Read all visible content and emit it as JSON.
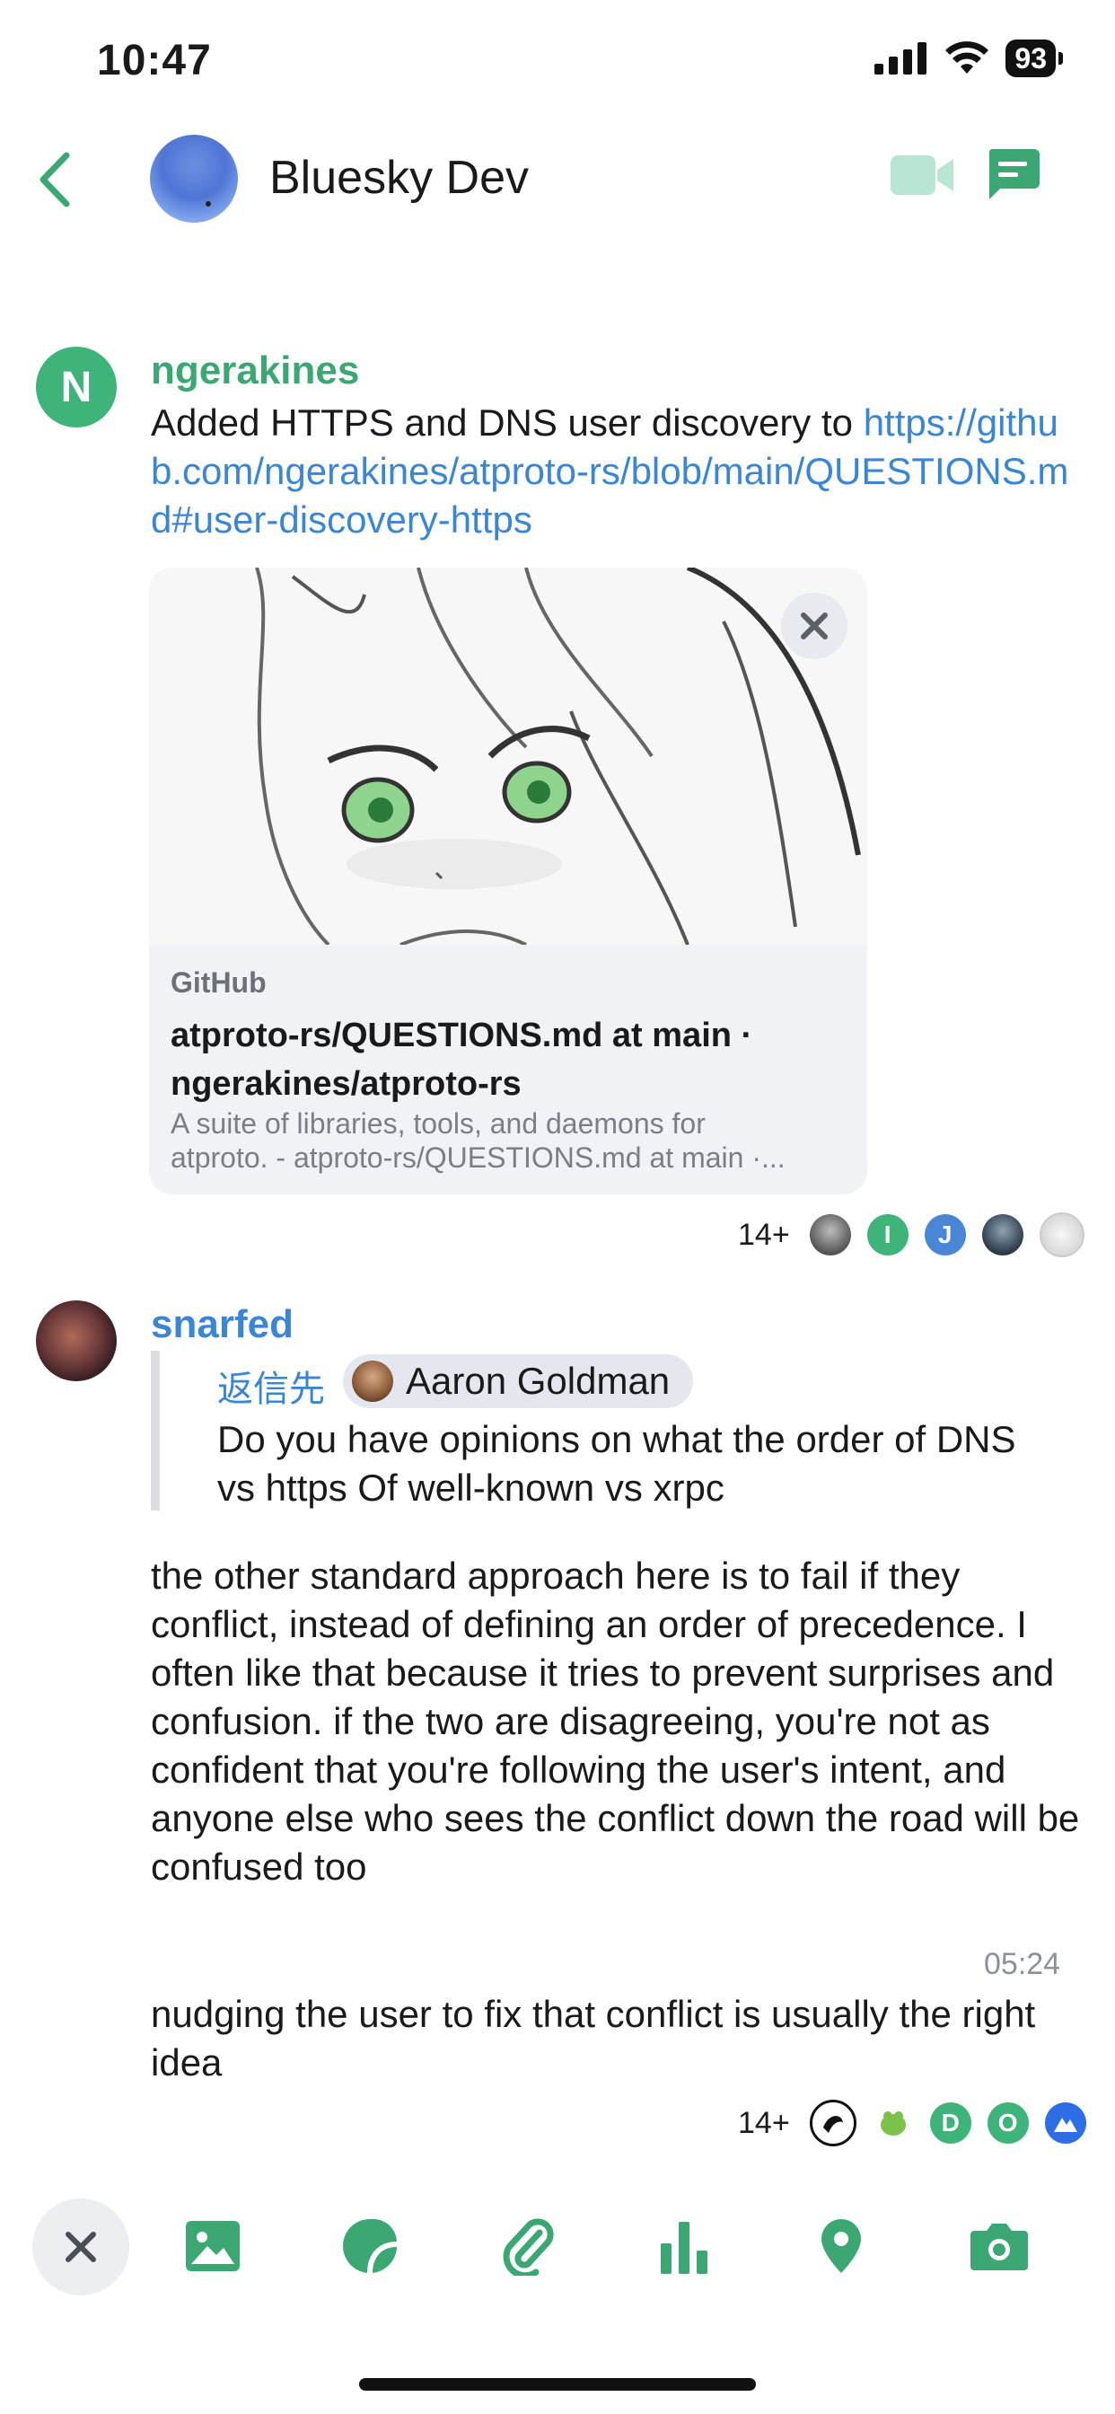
{
  "status_bar": {
    "time": "10:47",
    "battery": "93"
  },
  "header": {
    "title": "Bluesky Dev"
  },
  "colors": {
    "accent_green": "#3ba873",
    "link_blue": "#3a86d6"
  },
  "messages": [
    {
      "sender": "ngerakines",
      "avatar_initial": "N",
      "text": "Added HTTPS and DNS user discovery to ",
      "link": "https://github.com/ngerakines/atproto-rs/blob/main/QUESTIONS.md#user-discovery-https",
      "preview": {
        "site": "GitHub",
        "title": "atproto-rs/QUESTIONS.md at main · ngerakines/atproto-rs",
        "description_line1": "A suite of libraries, tools, and daemons for",
        "description_line2": "atproto. - atproto-rs/QUESTIONS.md at main ·..."
      },
      "receipts": {
        "count": "14+",
        "avatars": [
          "I",
          "J"
        ]
      }
    },
    {
      "sender": "snarfed",
      "reply": {
        "label": "返信先",
        "to": "Aaron Goldman",
        "quote": "Do you have opinions on what the order of DNS vs https Of well-known vs xrpc"
      },
      "text": "the other standard approach here is to fail if they conflict, instead of defining an order of precedence. I often like that because it tries to prevent surprises and confusion. if the two are disagreeing, you're not as confident that you're following the user's intent, and anyone else who sees the conflict down the road will be confused too",
      "time": "05:24"
    },
    {
      "text": "nudging the user to fix that conflict is usually the right idea",
      "receipts": {
        "count": "14+",
        "avatars": [
          "D",
          "O"
        ]
      }
    }
  ],
  "composer": {
    "icons": [
      "close-icon",
      "image-icon",
      "sticker-icon",
      "attachment-icon",
      "poll-icon",
      "location-icon",
      "camera-icon"
    ]
  }
}
